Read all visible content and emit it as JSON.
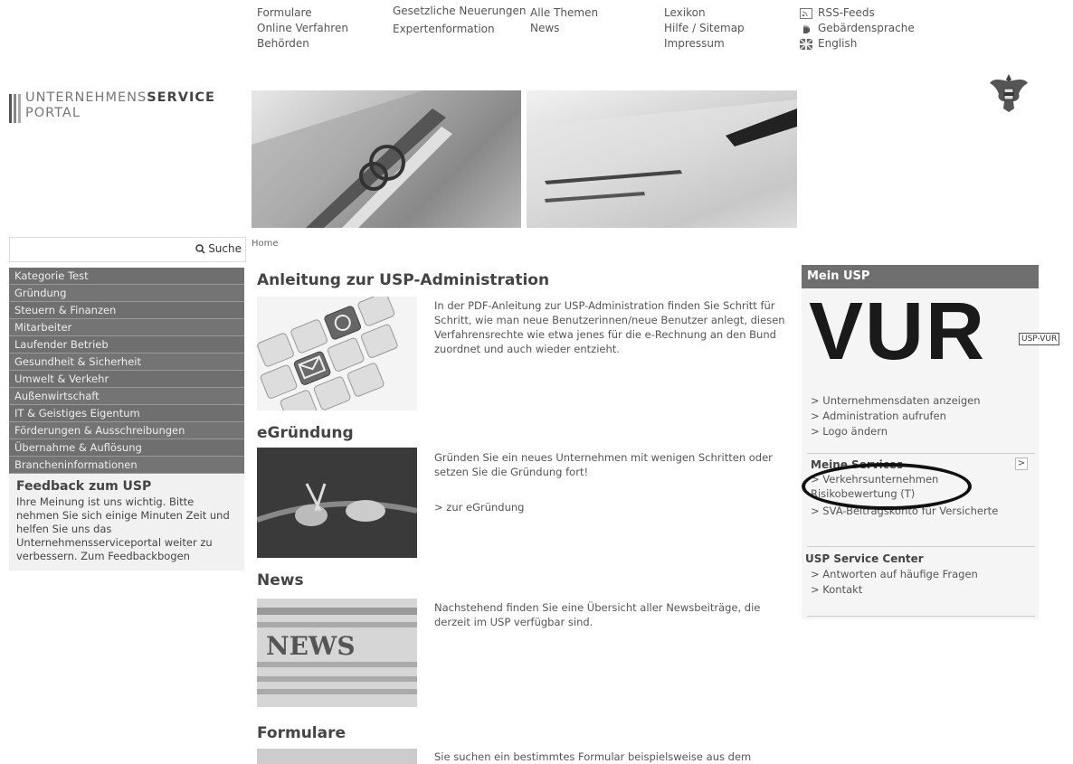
{
  "topnav": {
    "col1": [
      "Formulare",
      "Online Verfahren",
      "Behörden"
    ],
    "col2": [
      "Gesetzliche Neuerungen",
      "Expertenformation"
    ],
    "col3": [
      "Alle Themen",
      "News"
    ],
    "col4": [
      "Lexikon",
      "Hilfe / Sitemap",
      "Impressum"
    ],
    "col5": [
      "RSS-Feeds",
      "Gebärdensprache",
      "English"
    ]
  },
  "logo": {
    "line1_light": "UNTERNEHMENS",
    "line1_bold": "SERVICE",
    "line2": "PORTAL"
  },
  "search": {
    "placeholder": "",
    "button": "Suche"
  },
  "breadcrumb": "Home",
  "sidebar": {
    "items": [
      "Kategorie Test",
      "Gründung",
      "Steuern & Finanzen",
      "Mitarbeiter",
      "Laufender Betrieb",
      "Gesundheit & Sicherheit",
      "Umwelt & Verkehr",
      "Außenwirtschaft",
      "IT & Geistiges Eigentum",
      "Förderungen & Ausschreibungen",
      "Übernahme & Auflösung",
      "Brancheninformationen"
    ],
    "feedback_title": "Feedback zum USP",
    "feedback_text": "Ihre Meinung ist uns wichtig. Bitte nehmen Sie sich einige Minuten Zeit und helfen Sie uns das Unternehmensserviceportal weiter zu verbessern. Zum Feedbackbogen"
  },
  "main": {
    "admin_title": "Anleitung zur USP-Administration",
    "admin_text": "In der PDF-Anleitung zur USP-Administration finden Sie Schritt für Schritt, wie man neue Benutzerinnen/neue Benutzer anlegt, diesen Verfahrensrechte wie etwa jenes für die e-Rechnung an den Bund zuordnet und auch wieder entzieht.",
    "egr_title": "eGründung",
    "egr_text": "Gründen Sie ein neues Unternehmen mit wenigen Schritten oder setzen Sie die Gründung fort!",
    "egr_link": "> zur eGründung",
    "news_title": "News",
    "news_text": "Nachstehend finden Sie eine Übersicht aller Newsbeiträge, die derzeit im USP verfügbar sind.",
    "news_image_label": "NEWS",
    "form_title": "Formulare",
    "form_text": "Sie suchen ein bestimmtes Formular beispielsweise aus dem"
  },
  "mein": {
    "head": "Mein USP",
    "vur": "VUR",
    "vur_tag": "USP-VUR",
    "links": [
      "> Unternehmensdaten anzeigen",
      "> Administration aufrufen",
      "> Logo ändern"
    ],
    "services_head": "Meine Services",
    "services_toggle": ">",
    "services": [
      "> Verkehrsunternehmen Risikobewertung (T)",
      "> SVA-Beitragskonto für Versicherte"
    ],
    "center_head": "USP Service Center",
    "center_links": [
      "> Antworten auf häufige Fragen",
      "> Kontakt"
    ]
  }
}
